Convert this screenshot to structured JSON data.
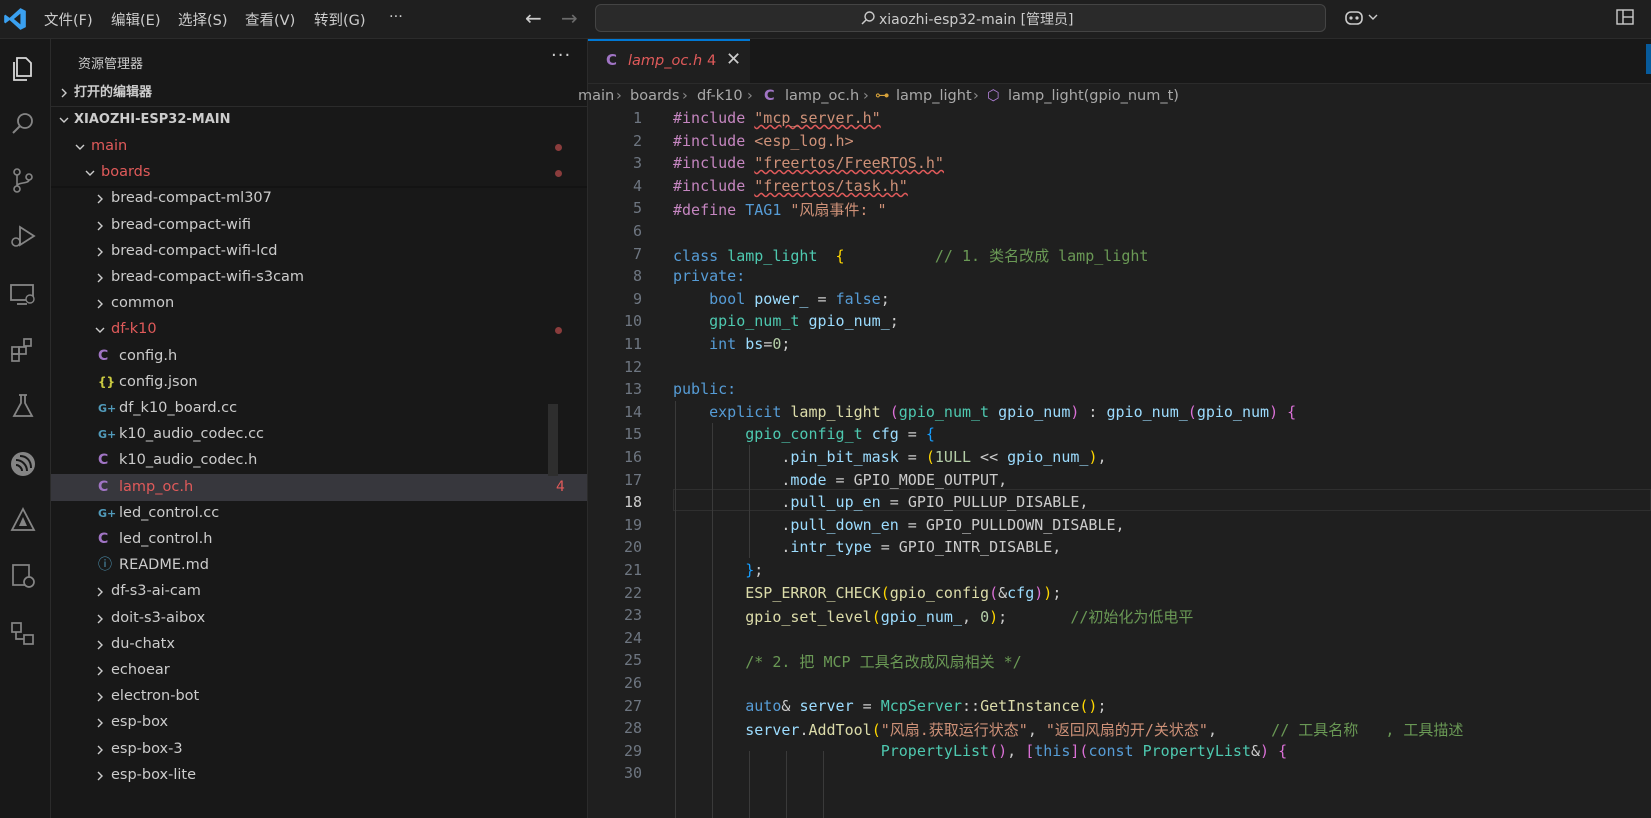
{
  "menu": [
    "文件(F)",
    "编辑(E)",
    "选择(S)",
    "查看(V)",
    "转到(G)",
    "···"
  ],
  "search_text": "xiaozhi-esp32-main [管理员]",
  "sidebar": {
    "title": "资源管理器",
    "more": "···",
    "open_editors": "打开的编辑器",
    "workspace": "XIAOZHI-ESP32-MAIN",
    "tree": [
      {
        "label": "main",
        "type": "folder-open",
        "level": 1,
        "dot": true,
        "modified": true
      },
      {
        "label": "boards",
        "type": "folder-open",
        "level": 2,
        "dot": true,
        "modified": true
      },
      {
        "label": "bread-compact-ml307",
        "type": "folder",
        "level": 3
      },
      {
        "label": "bread-compact-wifi",
        "type": "folder",
        "level": 3
      },
      {
        "label": "bread-compact-wifi-lcd",
        "type": "folder",
        "level": 3
      },
      {
        "label": "bread-compact-wifi-s3cam",
        "type": "folder",
        "level": 3
      },
      {
        "label": "common",
        "type": "folder",
        "level": 3
      },
      {
        "label": "df-k10",
        "type": "folder-open",
        "level": 3,
        "dot": true,
        "modified": true
      },
      {
        "label": "config.h",
        "type": "c",
        "level": 4
      },
      {
        "label": "config.json",
        "type": "json",
        "level": 4
      },
      {
        "label": "df_k10_board.cc",
        "type": "cpp",
        "level": 4
      },
      {
        "label": "k10_audio_codec.cc",
        "type": "cpp",
        "level": 4
      },
      {
        "label": "k10_audio_codec.h",
        "type": "c",
        "level": 4
      },
      {
        "label": "lamp_oc.h",
        "type": "c",
        "level": 4,
        "selected": true,
        "badge": "4",
        "modified": true
      },
      {
        "label": "led_control.cc",
        "type": "cpp",
        "level": 4
      },
      {
        "label": "led_control.h",
        "type": "c",
        "level": 4
      },
      {
        "label": "README.md",
        "type": "info",
        "level": 4
      },
      {
        "label": "df-s3-ai-cam",
        "type": "folder",
        "level": 3
      },
      {
        "label": "doit-s3-aibox",
        "type": "folder",
        "level": 3
      },
      {
        "label": "du-chatx",
        "type": "folder",
        "level": 3
      },
      {
        "label": "echoear",
        "type": "folder",
        "level": 3
      },
      {
        "label": "electron-bot",
        "type": "folder",
        "level": 3
      },
      {
        "label": "esp-box",
        "type": "folder",
        "level": 3
      },
      {
        "label": "esp-box-3",
        "type": "folder",
        "level": 3
      },
      {
        "label": "esp-box-lite",
        "type": "folder",
        "level": 3
      }
    ]
  },
  "tab": {
    "name": "lamp_oc.h",
    "problems": "4",
    "icon": "C"
  },
  "breadcrumbs": [
    "main",
    "boards",
    "df-k10",
    "lamp_oc.h",
    "lamp_light",
    "lamp_light(gpio_num_t)"
  ],
  "code_lines": [
    [
      [
        "pp",
        "#include "
      ],
      [
        "str squig",
        "\"mcp_server.h\""
      ]
    ],
    [
      [
        "pp",
        "#include "
      ],
      [
        "str",
        "<esp_log.h>"
      ]
    ],
    [
      [
        "pp",
        "#include "
      ],
      [
        "str squig",
        "\"freertos/FreeRTOS.h\""
      ]
    ],
    [
      [
        "pp",
        "#include "
      ],
      [
        "str squig",
        "\"freertos/task.h\""
      ]
    ],
    [
      [
        "pp",
        "#define "
      ],
      [
        "kw",
        "TAG1 "
      ],
      [
        "str",
        "\"风扇事件: \""
      ]
    ],
    [],
    [
      [
        "kw",
        "class "
      ],
      [
        "ty",
        "lamp_light "
      ],
      [
        "b1",
        " {"
      ],
      [
        "cm",
        "          // 1. 类名改成 lamp_light"
      ]
    ],
    [
      [
        "kw",
        "private:"
      ]
    ],
    [
      [
        "",
        "    "
      ],
      [
        "kw",
        "bool "
      ],
      [
        "var",
        "power_"
      ],
      [
        "",
        " = "
      ],
      [
        "kw",
        "false"
      ],
      [
        "",
        ";"
      ]
    ],
    [
      [
        "",
        "    "
      ],
      [
        "ty",
        "gpio_num_t "
      ],
      [
        "var",
        "gpio_num_"
      ],
      [
        "",
        ";"
      ]
    ],
    [
      [
        "",
        "    "
      ],
      [
        "kw",
        "int "
      ],
      [
        "var",
        "bs"
      ],
      [
        "",
        "="
      ],
      [
        "num",
        "0"
      ],
      [
        "",
        ";"
      ]
    ],
    [],
    [
      [
        "kw",
        "public:"
      ]
    ],
    [
      [
        "",
        "    "
      ],
      [
        "kw",
        "explicit "
      ],
      [
        "fn",
        "lamp_light "
      ],
      [
        "b2",
        "("
      ],
      [
        "ty",
        "gpio_num_t "
      ],
      [
        "var",
        "gpio_num"
      ],
      [
        "b2",
        ")"
      ],
      [
        "",
        " : "
      ],
      [
        "var",
        "gpio_num_"
      ],
      [
        "b2",
        "("
      ],
      [
        "var",
        "gpio_num"
      ],
      [
        "b2",
        ")"
      ],
      [
        "b2",
        " {"
      ]
    ],
    [
      [
        "",
        "        "
      ],
      [
        "ty",
        "gpio_config_t "
      ],
      [
        "var",
        "cfg"
      ],
      [
        "",
        " = "
      ],
      [
        "b3",
        "{"
      ]
    ],
    [
      [
        "",
        "            ."
      ],
      [
        "var",
        "pin_bit_mask"
      ],
      [
        "",
        " = "
      ],
      [
        "b1",
        "("
      ],
      [
        "num",
        "1ULL"
      ],
      [
        "",
        " << "
      ],
      [
        "var",
        "gpio_num_"
      ],
      [
        "b1",
        ")"
      ],
      [
        "",
        ","
      ]
    ],
    [
      [
        "",
        "            ."
      ],
      [
        "var",
        "mode"
      ],
      [
        "",
        " = "
      ],
      [
        "",
        "GPIO_MODE_OUTPUT,"
      ]
    ],
    [
      [
        "",
        "            ."
      ],
      [
        "var",
        "pull_up_en"
      ],
      [
        "",
        " = "
      ],
      [
        "",
        "GPIO_PULLUP_DISABLE,"
      ]
    ],
    [
      [
        "",
        "            ."
      ],
      [
        "var",
        "pull_down_en"
      ],
      [
        "",
        " = "
      ],
      [
        "",
        "GPIO_PULLDOWN_DISABLE,"
      ]
    ],
    [
      [
        "",
        "            ."
      ],
      [
        "var",
        "intr_type"
      ],
      [
        "",
        " = "
      ],
      [
        "",
        "GPIO_INTR_DISABLE,"
      ]
    ],
    [
      [
        "",
        "        "
      ],
      [
        "b3",
        "}"
      ],
      [
        "",
        ";"
      ]
    ],
    [
      [
        "",
        "        "
      ],
      [
        "fn",
        "ESP_ERROR_CHECK"
      ],
      [
        "b1",
        "("
      ],
      [
        "fn",
        "gpio_config"
      ],
      [
        "b2",
        "("
      ],
      [
        "",
        "&"
      ],
      [
        "var",
        "cfg"
      ],
      [
        "b2",
        ")"
      ],
      [
        "b1",
        ")"
      ],
      [
        "",
        ";"
      ]
    ],
    [
      [
        "",
        "        "
      ],
      [
        "fn",
        "gpio_set_level"
      ],
      [
        "b1",
        "("
      ],
      [
        "var",
        "gpio_num_"
      ],
      [
        "",
        ", "
      ],
      [
        "num",
        "0"
      ],
      [
        "b1",
        ")"
      ],
      [
        "",
        ";"
      ],
      [
        "cm",
        "       //初始化为低电平"
      ]
    ],
    [],
    [
      [
        "",
        "        "
      ],
      [
        "cm",
        "/* 2. 把 MCP 工具名改成风扇相关 */"
      ]
    ],
    [],
    [
      [
        "",
        "        "
      ],
      [
        "kw",
        "auto"
      ],
      [
        "",
        "& "
      ],
      [
        "var",
        "server"
      ],
      [
        "",
        " = "
      ],
      [
        "ty",
        "McpServer"
      ],
      [
        "",
        "::"
      ],
      [
        "fn",
        "GetInstance"
      ],
      [
        "b1",
        "()"
      ],
      [
        "",
        ";"
      ]
    ],
    [
      [
        "",
        "        "
      ],
      [
        "var",
        "server"
      ],
      [
        "",
        "."
      ],
      [
        "fn",
        "AddTool"
      ],
      [
        "b1",
        "("
      ],
      [
        "str",
        "\"风扇.获取运行状态\""
      ],
      [
        "",
        ", "
      ],
      [
        "str",
        "\"返回风扇的开/关状态\""
      ],
      [
        "",
        ","
      ],
      [
        "cm",
        "      // 工具名称   , 工具描述"
      ]
    ],
    [
      [
        "",
        "                       "
      ],
      [
        "ty",
        "PropertyList"
      ],
      [
        "b2",
        "()"
      ],
      [
        "",
        ", "
      ],
      [
        "b2",
        "["
      ],
      [
        "kw",
        "this"
      ],
      [
        "b2",
        "]"
      ],
      [
        "b2",
        "("
      ],
      [
        "kw",
        "const "
      ],
      [
        "ty",
        "PropertyList"
      ],
      [
        "",
        "&"
      ],
      [
        "b2",
        ")"
      ],
      [
        "b2",
        " {"
      ]
    ],
    []
  ],
  "current_line": 18
}
